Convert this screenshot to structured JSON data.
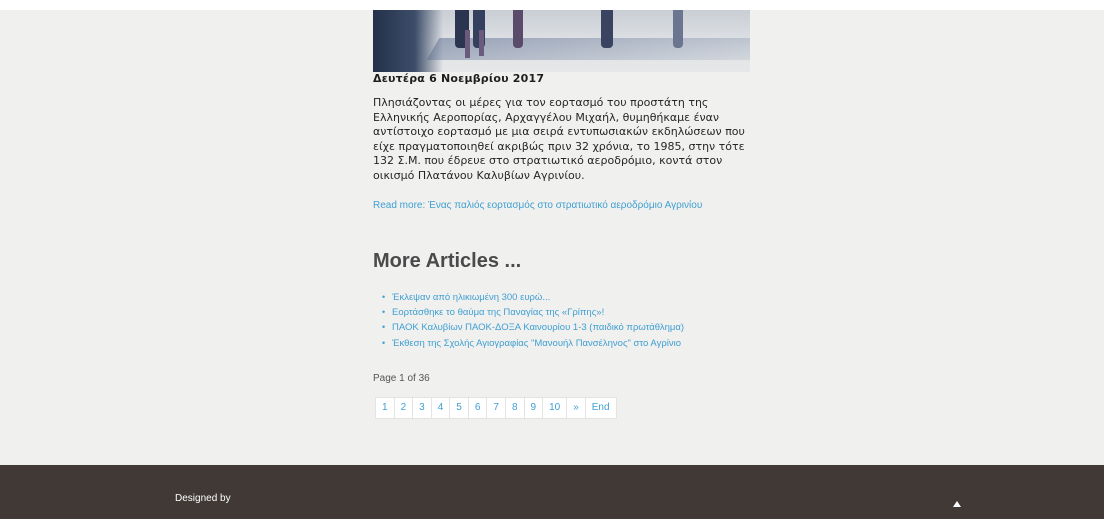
{
  "article": {
    "image_alt": "street crowd photo",
    "date": "Δευτέρα 6 Νοεμβρίου 2017",
    "body": "Πλησιάζοντας οι μέρες για τον εορτασμό του προστάτη της Ελληνικής Αεροπορίας, Αρχαγγέλου Μιχαήλ, θυμηθήκαμε έναν αντίστοιχο εορτασμό με μια σειρά εντυπωσιακών εκδηλώσεων που είχε πραγματοποιηθεί ακριβώς πριν 32 χρόνια, το 1985, στην τότε 132 Σ.Μ. που έδρευε στο στρατιωτικό αεροδρόμιο, κοντά στον οικισμό Πλατάνου Καλυβίων Αγρινίου.",
    "read_more": "Read more: Ένας παλιός εορτασμός στο στρατιωτικό αεροδρόμιο Αγρινίου"
  },
  "more_articles": {
    "heading": "More Articles ...",
    "items": [
      "Έκλεψαν από ηλικιωμένη 300 ευρώ...",
      "Εορτάσθηκε το θαύμα της Παναγίας της «Γρίπης»!",
      "ΠΑΟΚ Καλυβίων ΠΑΟΚ-ΔΟΞΑ Καινουρίου 1-3 (παιδικό πρωτάθλημα)",
      "Έκθεση της Σχολής Αγιογραφίας \"Μανουήλ Πανσέληνος\" στο Αγρίνιο"
    ]
  },
  "pagination": {
    "counter": "Page 1 of 36",
    "pages": [
      "1",
      "2",
      "3",
      "4",
      "5",
      "6",
      "7",
      "8",
      "9",
      "10"
    ],
    "next": "»",
    "end": "End"
  },
  "footer": {
    "designed_by": "Designed by",
    "back_to_top_icon": "caret-up-icon"
  },
  "colors": {
    "link": "#3f9fd1",
    "background": "#f0f0ef",
    "footer": "#403936"
  }
}
